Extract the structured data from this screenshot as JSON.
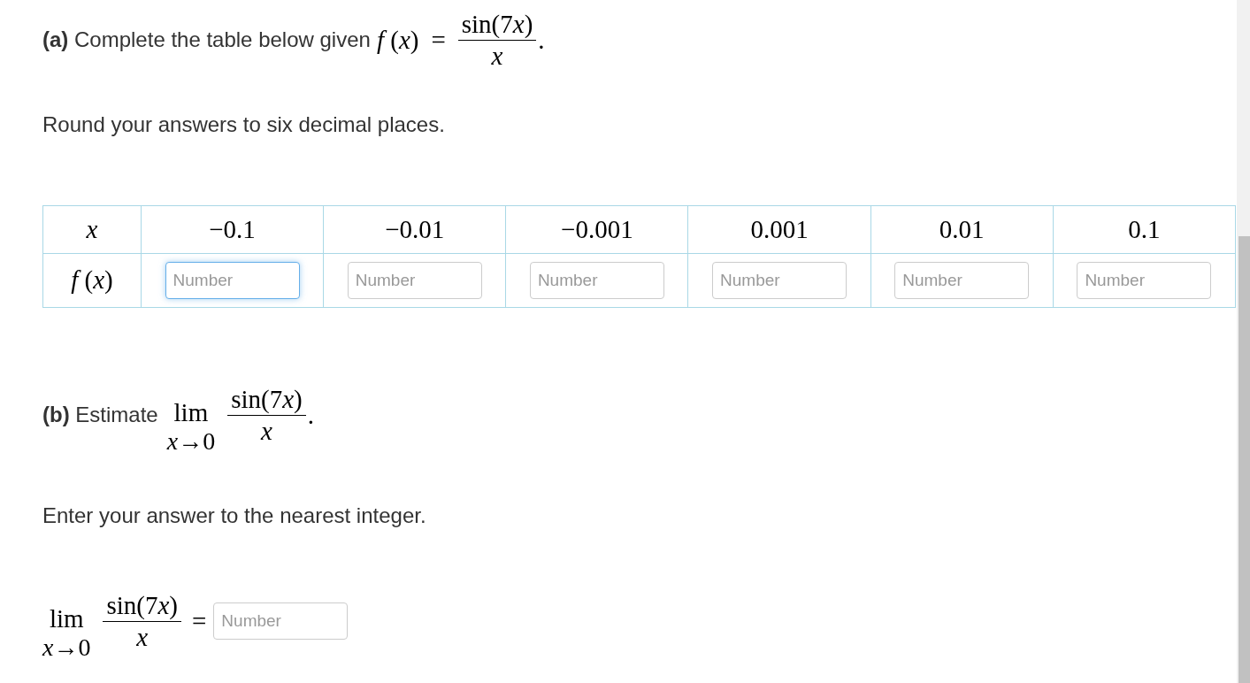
{
  "part_a": {
    "prompt": "**(a)** Complete the table below given",
    "formula": {
      "lhs": "*f* (*x*)",
      "relation": "=",
      "numerator": [
        {
          "text": "sin(7",
          "italic": false
        },
        {
          "text": "x",
          "italic": true
        },
        {
          "text": ")",
          "italic": false
        }
      ],
      "denominator": "x",
      "punctuation": "."
    },
    "instruction": "Round your answers to six decimal places."
  },
  "table": {
    "header_label": "x",
    "row_label": "*f* (*x*)",
    "columns": [
      {
        "value": "−0.1",
        "field": {
          "placeholder": "Number",
          "focused": true
        }
      },
      {
        "value": "−0.01",
        "field": {
          "placeholder": "Number",
          "focused": false
        }
      },
      {
        "value": "−0.001",
        "field": {
          "placeholder": "Number",
          "focused": false
        }
      },
      {
        "value": "0.001",
        "field": {
          "placeholder": "Number",
          "focused": false
        }
      },
      {
        "value": "0.01",
        "field": {
          "placeholder": "Number",
          "focused": false
        }
      },
      {
        "value": "0.1",
        "field": {
          "placeholder": "Number",
          "focused": false
        }
      }
    ]
  },
  "part_b": {
    "prompt": "**(b)** Estimate",
    "formula": {
      "limit": "lim",
      "limit_under": "*x*→0",
      "numerator": [
        {
          "text": "sin(7",
          "italic": false
        },
        {
          "text": "x",
          "italic": true
        },
        {
          "text": ")",
          "italic": false
        }
      ],
      "denominator": "x",
      "punctuation": "."
    },
    "instruction": "Enter your answer to the nearest integer."
  },
  "answer": {
    "formula": {
      "limit": "lim",
      "limit_under": "*x*→0",
      "numerator": [
        {
          "text": "sin(7",
          "italic": false
        },
        {
          "text": "x",
          "italic": true
        },
        {
          "text": ")",
          "italic": false
        }
      ],
      "denominator": "x"
    },
    "relation": "=",
    "field": {
      "placeholder": "Number",
      "focused": false
    }
  }
}
